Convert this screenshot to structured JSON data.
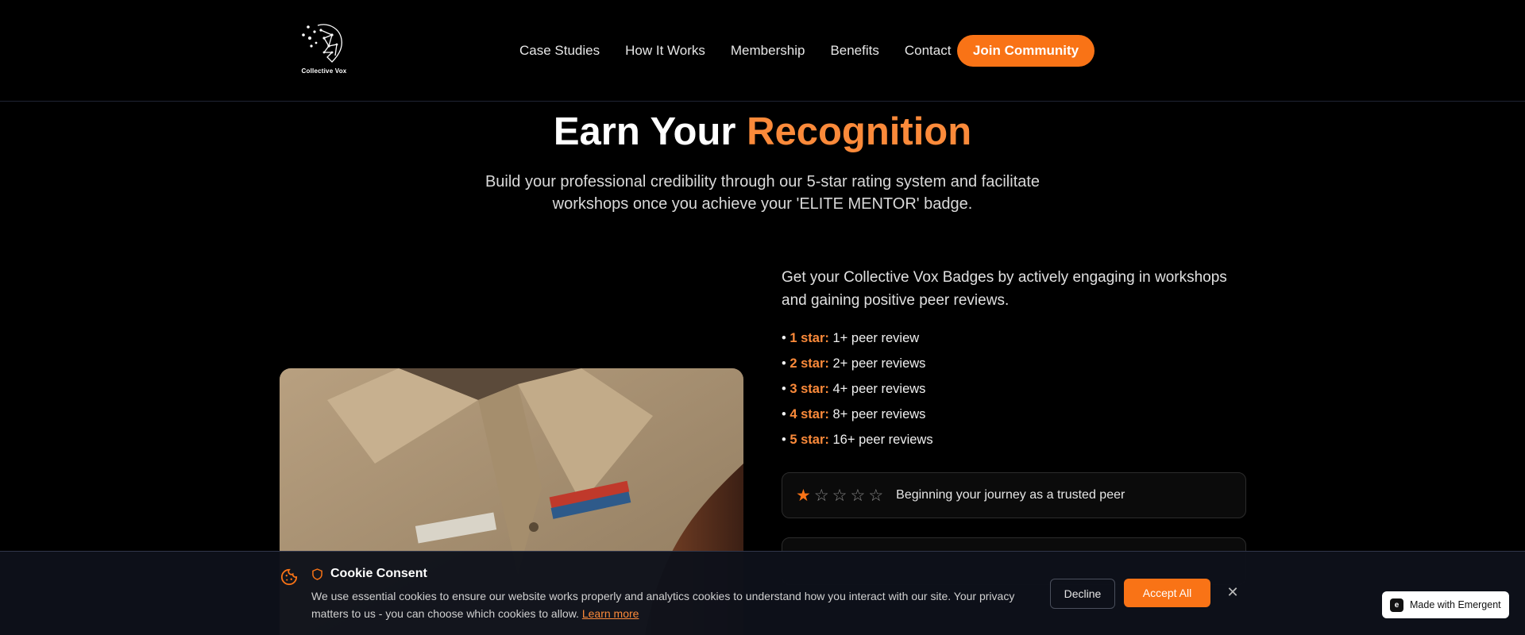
{
  "header": {
    "logo_text": "Collective Vox",
    "nav": [
      "Case Studies",
      "How It Works",
      "Membership",
      "Benefits",
      "Contact"
    ],
    "cta_label": "Join Community"
  },
  "hero": {
    "title_main": "Earn Your ",
    "title_accent": "Recognition",
    "subtitle": "Build your professional credibility through our 5-star rating system and facilitate workshops once you achieve your 'ELITE MENTOR' badge."
  },
  "badges": {
    "intro": "Get your Collective Vox Badges by actively engaging in workshops and gaining positive peer reviews.",
    "tiers": [
      {
        "label": "1 star:",
        "desc": " 1+ peer review"
      },
      {
        "label": "2 star:",
        "desc": " 2+ peer reviews"
      },
      {
        "label": "3 star:",
        "desc": " 4+ peer reviews"
      },
      {
        "label": "4 star:",
        "desc": " 8+ peer reviews"
      },
      {
        "label": "5 star:",
        "desc": " 16+ peer reviews"
      }
    ],
    "card": {
      "rating": 1,
      "max": 5,
      "text": "Beginning your journey as a trusted peer"
    }
  },
  "cookie": {
    "title": "Cookie Consent",
    "text": "We use essential cookies to ensure our website works properly and analytics cookies to understand how you interact with our site. Your privacy matters to us - you can choose which cookies to allow.",
    "link": "Learn more",
    "decline": "Decline",
    "accept": "Accept All",
    "close": "✕"
  },
  "badge_footer": "Made with Emergent",
  "colors": {
    "accent": "#f97316",
    "accent_text": "#fb8a3a",
    "background": "#000000"
  }
}
